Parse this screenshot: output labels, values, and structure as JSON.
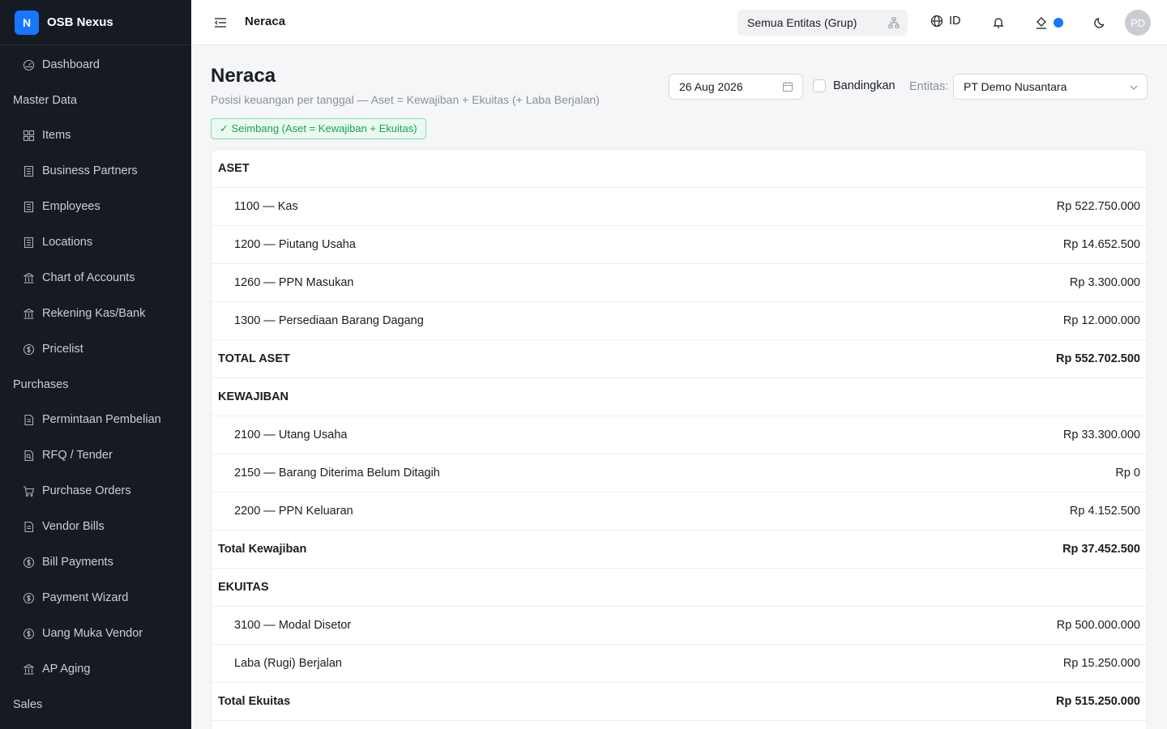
{
  "brand": {
    "logo_letter": "N",
    "name": "OSB Nexus",
    "color": "#1677ff"
  },
  "sidebar": {
    "items": [
      {
        "type": "item",
        "label": "Dashboard",
        "icon": "dashboard-icon"
      },
      {
        "type": "group",
        "label": "Master Data"
      },
      {
        "type": "item",
        "label": "Items",
        "icon": "grid-icon"
      },
      {
        "type": "item",
        "label": "Business Partners",
        "icon": "building-icon"
      },
      {
        "type": "item",
        "label": "Employees",
        "icon": "building-icon"
      },
      {
        "type": "item",
        "label": "Locations",
        "icon": "building-icon"
      },
      {
        "type": "item",
        "label": "Chart of Accounts",
        "icon": "bank-icon"
      },
      {
        "type": "item",
        "label": "Rekening Kas/Bank",
        "icon": "bank-icon"
      },
      {
        "type": "item",
        "label": "Pricelist",
        "icon": "dollar-circle-icon"
      },
      {
        "type": "group",
        "label": "Purchases"
      },
      {
        "type": "item",
        "label": "Permintaan Pembelian",
        "icon": "file-icon"
      },
      {
        "type": "item",
        "label": "RFQ / Tender",
        "icon": "file-search-icon"
      },
      {
        "type": "item",
        "label": "Purchase Orders",
        "icon": "cart-icon"
      },
      {
        "type": "item",
        "label": "Vendor Bills",
        "icon": "file-icon"
      },
      {
        "type": "item",
        "label": "Bill Payments",
        "icon": "dollar-circle-icon"
      },
      {
        "type": "item",
        "label": "Payment Wizard",
        "icon": "dollar-circle-icon"
      },
      {
        "type": "item",
        "label": "Uang Muka Vendor",
        "icon": "dollar-circle-icon"
      },
      {
        "type": "item",
        "label": "AP Aging",
        "icon": "bank-icon"
      },
      {
        "type": "group",
        "label": "Sales"
      }
    ]
  },
  "header": {
    "title": "Neraca",
    "entity_switch": "Semua Entitas (Grup)",
    "language": "ID",
    "avatar_initials": "PD",
    "status_dot_color": "#1677ff"
  },
  "page": {
    "title": "Neraca",
    "subtitle": "Posisi keuangan per tanggal — Aset = Kewajiban + Ekuitas (+ Laba Berjalan)",
    "balance_badge": "✓ Seimbang (Aset = Kewajiban + Ekuitas)",
    "date_value": "26 Aug 2026",
    "compare_label": "Bandingkan",
    "compare_checked": false,
    "entity_label": "Entitas:",
    "entity_value": "PT Demo Nusantara"
  },
  "report": {
    "rows": [
      {
        "type": "section",
        "label": "ASET",
        "amount": ""
      },
      {
        "type": "account",
        "label": "1100 — Kas",
        "amount": "Rp 522.750.000"
      },
      {
        "type": "account",
        "label": "1200 — Piutang Usaha",
        "amount": "Rp 14.652.500"
      },
      {
        "type": "account",
        "label": "1260 — PPN Masukan",
        "amount": "Rp 3.300.000"
      },
      {
        "type": "account",
        "label": "1300 — Persediaan Barang Dagang",
        "amount": "Rp 12.000.000"
      },
      {
        "type": "total",
        "label": "TOTAL ASET",
        "amount": "Rp 552.702.500"
      },
      {
        "type": "section",
        "label": "KEWAJIBAN",
        "amount": ""
      },
      {
        "type": "account",
        "label": "2100 — Utang Usaha",
        "amount": "Rp 33.300.000"
      },
      {
        "type": "account",
        "label": "2150 — Barang Diterima Belum Ditagih",
        "amount": "Rp 0"
      },
      {
        "type": "account",
        "label": "2200 — PPN Keluaran",
        "amount": "Rp 4.152.500"
      },
      {
        "type": "total",
        "label": "Total Kewajiban",
        "amount": "Rp 37.452.500"
      },
      {
        "type": "section",
        "label": "EKUITAS",
        "amount": ""
      },
      {
        "type": "account",
        "label": "3100 — Modal Disetor",
        "amount": "Rp 500.000.000"
      },
      {
        "type": "account",
        "label": "Laba (Rugi) Berjalan",
        "amount": "Rp 15.250.000"
      },
      {
        "type": "total",
        "label": "Total Ekuitas",
        "amount": "Rp 515.250.000"
      }
    ]
  }
}
